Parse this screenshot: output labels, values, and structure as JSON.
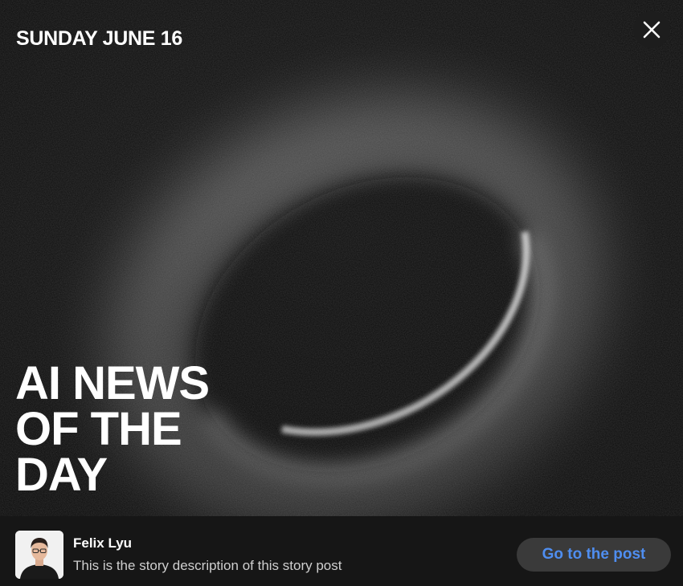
{
  "story": {
    "date": "SUNDAY JUNE 16",
    "headline": [
      "AI NEWS",
      "OF THE",
      "DAY"
    ],
    "close_icon": "close-icon"
  },
  "footer": {
    "author_name": "Felix Lyu",
    "description": "This is the story description of this story post",
    "cta_label": "Go to the post"
  },
  "colors": {
    "background": "#121212",
    "footer_background": "#161616",
    "cta_background": "#3a3a3a",
    "cta_text": "#4f8ef0",
    "text": "#ffffff"
  }
}
